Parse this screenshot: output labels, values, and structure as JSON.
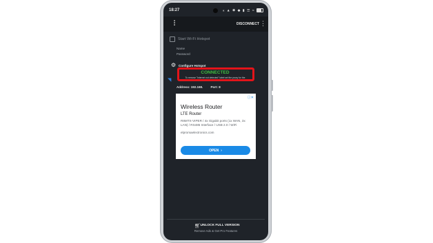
{
  "status_bar": {
    "time": "18:27",
    "indicators": "⁎ ▲ ✱ ◆ ▮ ☰ ≈"
  },
  "app_bar": {
    "logo_icon": "tether-logo-icon",
    "disconnect_label": "DISCONNECT",
    "menu_icon": "⋮"
  },
  "hotspot": {
    "start_label": "Start Wi-Fi Hotspot",
    "name_label": "Name",
    "password_label": "Password",
    "configure_label": "Configure Hotspot"
  },
  "connection": {
    "status": "CONNECTED",
    "hint": "To remove \"Internet not detected\" label set the proxy for the",
    "address": "Address: 192.168.",
    "port": "Port: 8",
    "status_color": "#3fbf3f",
    "highlight_color": "#e3141a"
  },
  "ad": {
    "title": "Wireless Router",
    "subtitle": "LTE Router",
    "description": "R8MTX-VIPER / 4x Gigabit ports (1x WAN, 3x LAN) / RS485 Interface / USB 2.0 / WiFi",
    "domain": "elpromaelectronics.com",
    "open_label": "OPEN",
    "accent": "#1a8ae6"
  },
  "bottom": {
    "unlock_label": "UNLOCK FULL VERSION",
    "unlock_sub": "Remove Ads & Get Pro Features"
  }
}
